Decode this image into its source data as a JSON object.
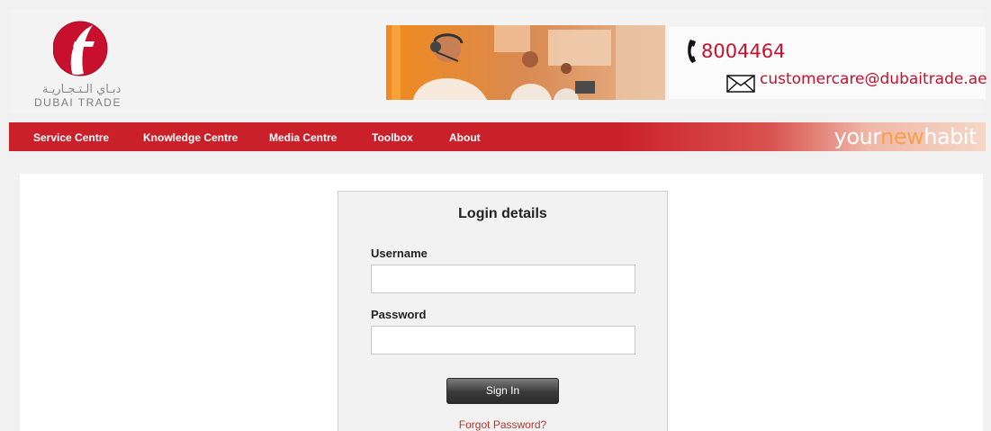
{
  "header": {
    "logo_arabic": "دبـاي الـتـجـاريـة",
    "logo_english": "DUBAI TRADE",
    "phone": "8004464",
    "email": "customercare@dubaitrade.ae"
  },
  "nav": {
    "items": [
      {
        "label": "Service Centre"
      },
      {
        "label": "Knowledge Centre"
      },
      {
        "label": "Media Centre"
      },
      {
        "label": "Toolbox"
      },
      {
        "label": "About"
      }
    ],
    "tagline": {
      "part1": "your",
      "part2": "new",
      "part3": "habit"
    }
  },
  "login": {
    "title": "Login details",
    "username_label": "Username",
    "username_value": "",
    "password_label": "Password",
    "password_value": "",
    "signin_label": "Sign In",
    "forgot_label": "Forgot Password?"
  },
  "colors": {
    "brand_red": "#c9202a",
    "accent_orange": "#f6a14e",
    "link_red": "#b5342a"
  }
}
